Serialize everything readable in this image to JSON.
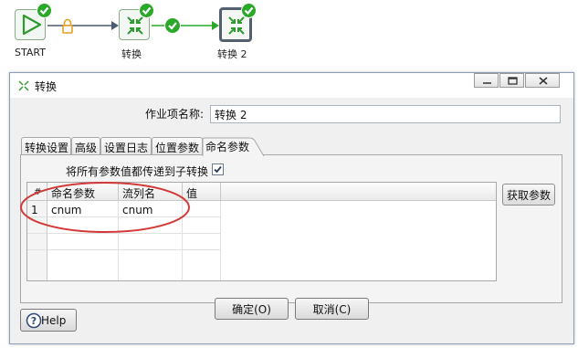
{
  "workflow": {
    "nodes": [
      {
        "label": "START",
        "icon": "play-icon",
        "status": "success"
      },
      {
        "label": "转换",
        "icon": "transform-icon",
        "status": "success"
      },
      {
        "label": "转换 2",
        "icon": "transform-icon",
        "status": "success",
        "selected": true
      }
    ],
    "hops": [
      "locked-hop",
      "normal-hop",
      "success-hop"
    ]
  },
  "dialog": {
    "title": "转换",
    "job_entry_label": "作业项名称:",
    "job_entry_value": "转换 2",
    "tabs": [
      "转换设置",
      "高级",
      "设置日志",
      "位置参数",
      "命名参数"
    ],
    "active_tab": "命名参数",
    "pass_all_params_label": "将所有参数值都传递到子转换",
    "pass_all_params_checked": true,
    "table": {
      "columns": [
        "#",
        "命名参数",
        "流列名",
        "值"
      ],
      "rows": [
        {
          "num": "1",
          "param": "cnum",
          "stream_column": "cnum",
          "value": ""
        }
      ]
    },
    "get_params_label": "获取参数",
    "ok_label": "确定(O)",
    "cancel_label": "取消(C)",
    "help_label": "Help"
  },
  "colors": {
    "success_green": "#2aa82a",
    "annotation_red": "#d23a3a",
    "lock_orange": "#e8a020",
    "hop_blue": "#4a5a70"
  }
}
